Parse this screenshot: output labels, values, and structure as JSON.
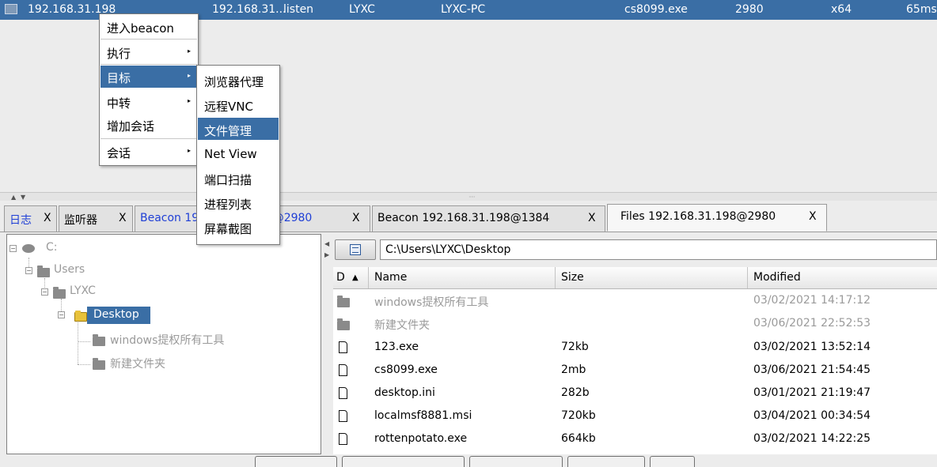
{
  "session_row": {
    "external": "192.168.31.198",
    "internal": "192.168.31...",
    "listener": "listen",
    "user": "LYXC",
    "computer": "LYXC-PC",
    "process": "cs8099.exe",
    "pid": "2980",
    "arch": "x64",
    "last": "65ms"
  },
  "context_menu": {
    "items": [
      {
        "label": "进入beacon"
      },
      {
        "label": "执行",
        "submenu_arrow": "▸"
      },
      {
        "label": "目标",
        "submenu_arrow": "▸"
      },
      {
        "label": "中转",
        "submenu_arrow": "▸"
      },
      {
        "label": "增加会话"
      },
      {
        "label": "会话",
        "submenu_arrow": "▸"
      }
    ]
  },
  "submenu": {
    "items": [
      "浏览器代理",
      "远程VNC",
      "文件管理",
      "Net View",
      "端口扫描",
      "进程列表",
      "屏幕截图"
    ],
    "highlighted": "文件管理"
  },
  "tabs": [
    {
      "label": "日志",
      "close": "X"
    },
    {
      "label": "监听器",
      "close": "X"
    },
    {
      "label": "Beacon 192.168.31.198@2980",
      "close": "X"
    },
    {
      "label": "Beacon 192.168.31.198@1384",
      "close": "X"
    },
    {
      "label": "Files 192.168.31.198@2980",
      "close": "X"
    }
  ],
  "tree": {
    "root": "C:",
    "users": "Users",
    "lyxc": "LYXC",
    "desktop": "Desktop",
    "child1": "windows提权所有工具",
    "child2": "新建文件夹"
  },
  "path_bar": {
    "path": "C:\\Users\\LYXC\\Desktop"
  },
  "files_table": {
    "columns": [
      "D",
      "Name",
      "Size",
      "Modified"
    ],
    "sort_indicator": "▲",
    "rows": [
      {
        "type": "folder",
        "name": "windows提权所有工具",
        "size": "",
        "modified": "03/02/2021 14:17:12"
      },
      {
        "type": "folder",
        "name": "新建文件夹",
        "size": "",
        "modified": "03/06/2021 22:52:53"
      },
      {
        "type": "file",
        "name": "123.exe",
        "size": "72kb",
        "modified": "03/02/2021 13:52:14"
      },
      {
        "type": "file",
        "name": "cs8099.exe",
        "size": "2mb",
        "modified": "03/06/2021 21:54:45"
      },
      {
        "type": "file",
        "name": "desktop.ini",
        "size": "282b",
        "modified": "03/01/2021 21:19:47"
      },
      {
        "type": "file",
        "name": "localmsf8881.msi",
        "size": "720kb",
        "modified": "03/04/2021 00:34:54"
      },
      {
        "type": "file",
        "name": "rottenpotato.exe",
        "size": "664kb",
        "modified": "03/02/2021 14:22:25"
      }
    ]
  },
  "colors": {
    "selection": "#3a6ea5",
    "tab_link": "#1f3fd6",
    "dim_text": "#9a9a9a"
  }
}
